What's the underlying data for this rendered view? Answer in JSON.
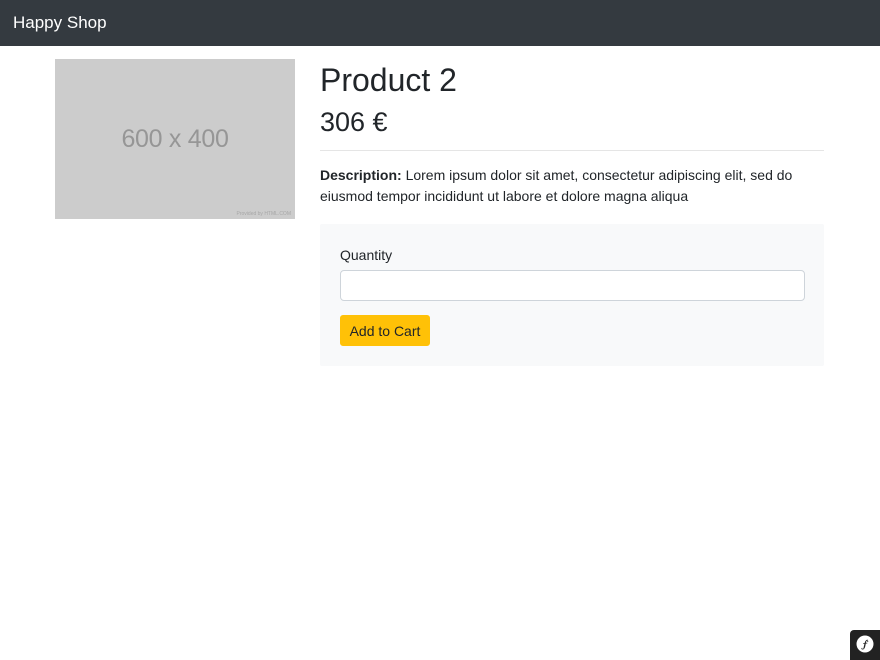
{
  "navbar": {
    "brand": "Happy Shop"
  },
  "product": {
    "image_label": "600 x 400",
    "image_credit": "Provided by HTML.COM",
    "title": "Product 2",
    "price": "306 €",
    "description_label": "Description:",
    "description_text": " Lorem ipsum dolor sit amet, consectetur adipiscing elit, sed do eiusmod tempor incididunt ut labore et dolore magna aliqua"
  },
  "cart_form": {
    "quantity_label": "Quantity",
    "quantity_value": "",
    "add_button_label": "Add to Cart"
  },
  "toolbar": {
    "icon": "symfony-logo-icon"
  },
  "colors": {
    "navbar_bg": "#343a40",
    "button_bg": "#ffc107",
    "panel_bg": "#f8f9fa",
    "placeholder_bg": "#cccccc"
  }
}
